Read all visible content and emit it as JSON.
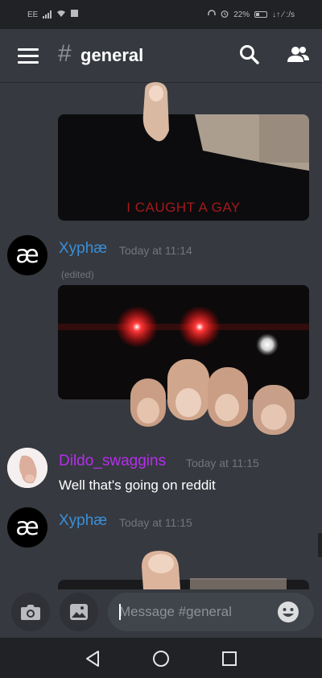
{
  "status_bar": {
    "left_text": "EE",
    "battery_percent": "22%",
    "speed_text": "↓↑ ⁄ :/s"
  },
  "header": {
    "hash_symbol": "#",
    "channel_name": "general",
    "icons": [
      "menu-icon",
      "search-icon",
      "members-icon"
    ]
  },
  "messages": [
    {
      "type": "image",
      "image_caption_text": "I CAUGHT A GAY"
    },
    {
      "type": "message",
      "avatar_text": "æ",
      "username": "Xyphæ",
      "username_color": "#3b8fd9",
      "timestamp": "Today at 11:14",
      "edited_label": "(edited)"
    },
    {
      "type": "message",
      "username": "Dildo_swaggins",
      "username_color": "#b62df0",
      "timestamp": "Today at 11:15",
      "text": "Well that's going on reddit"
    },
    {
      "type": "message",
      "avatar_text": "æ",
      "username": "Xyphæ",
      "username_color": "#3b8fd9",
      "timestamp": "Today at 11:15"
    }
  ],
  "composer": {
    "placeholder": "Message #general",
    "icons": [
      "camera-icon",
      "image-icon",
      "emoji-icon"
    ]
  },
  "nav_bar": {
    "icons": [
      "back-icon",
      "home-icon",
      "recents-icon"
    ]
  },
  "colors": {
    "background": "#36393f",
    "header_bg": "#36393f",
    "status_bar_bg": "#202225",
    "input_bg": "#40444b"
  }
}
